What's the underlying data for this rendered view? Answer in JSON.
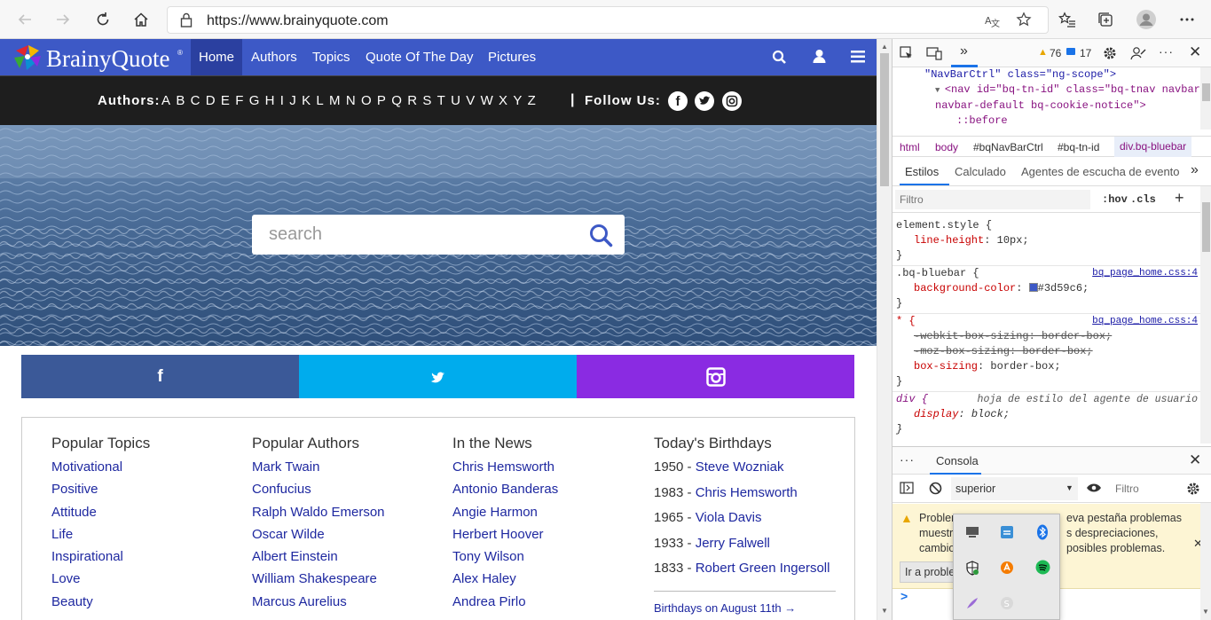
{
  "browser": {
    "url": "https://www.brainyquote.com",
    "back_icon": "back-arrow-icon",
    "forward_icon": "forward-arrow-icon",
    "reload_icon": "reload-icon",
    "home_icon": "home-icon"
  },
  "site": {
    "logo_text": "BrainyQuote",
    "logo_reg": "®",
    "nav": [
      "Home",
      "Authors",
      "Topics",
      "Quote Of The Day",
      "Pictures"
    ],
    "authors_label": "Authors:",
    "letters": [
      "A",
      "B",
      "C",
      "D",
      "E",
      "F",
      "G",
      "H",
      "I",
      "J",
      "K",
      "L",
      "M",
      "N",
      "O",
      "P",
      "Q",
      "R",
      "S",
      "T",
      "U",
      "V",
      "W",
      "X",
      "Y",
      "Z"
    ],
    "divider": "|",
    "follow_label": "Follow Us:",
    "search_placeholder": "search",
    "colors": {
      "bluebar": "#3d59c6",
      "facebook": "#3b5998",
      "twitter": "#00aced",
      "instagram": "#8a2be2"
    }
  },
  "panel": {
    "popular_topics": {
      "title": "Popular Topics",
      "items": [
        "Motivational",
        "Positive",
        "Attitude",
        "Life",
        "Inspirational",
        "Love",
        "Beauty"
      ]
    },
    "popular_authors": {
      "title": "Popular Authors",
      "items": [
        "Mark Twain",
        "Confucius",
        "Ralph Waldo Emerson",
        "Oscar Wilde",
        "Albert Einstein",
        "William Shakespeare",
        "Marcus Aurelius"
      ]
    },
    "in_the_news": {
      "title": "In the News",
      "items": [
        "Chris Hemsworth",
        "Antonio Banderas",
        "Angie Harmon",
        "Herbert Hoover",
        "Tony Wilson",
        "Alex Haley",
        "Andrea Pirlo"
      ]
    },
    "birthdays": {
      "title": "Today's Birthdays",
      "items": [
        {
          "year": "1950 - ",
          "name": "Steve Wozniak"
        },
        {
          "year": "1983 - ",
          "name": "Chris Hemsworth"
        },
        {
          "year": "1965 - ",
          "name": "Viola Davis"
        },
        {
          "year": "1933 - ",
          "name": "Jerry Falwell"
        },
        {
          "year": "1833 - ",
          "name": "Robert Green Ingersoll"
        }
      ],
      "more_link": "Birthdays on August 11th →"
    }
  },
  "devtools": {
    "warnings": "76",
    "messages": "17",
    "dom_lines": [
      "\"NavBarCtrl\" class=\"ng-scope\">",
      "<nav id=\"bq-tn-id\" class=\"bq-tnav navbar",
      "navbar-default bq-cookie-notice\">",
      "::before"
    ],
    "breadcrumbs": [
      "html",
      "body",
      "#bqNavBarCtrl",
      "#bq-tn-id",
      "div.bq-bluebar"
    ],
    "style_tabs": [
      "Estilos",
      "Calculado",
      "Agentes de escucha de evento"
    ],
    "filter_placeholder": "Filtro",
    "hov": ":hov",
    "cls": ".cls",
    "rules": {
      "r1_selector": "element.style {",
      "r1_prop": "line-height",
      "r1_val": "10px;",
      "r2_selector": ".bq-bluebar {",
      "r2_source": "bq_page_home.css:4",
      "r2_prop": "background-color",
      "r2_val": "#3d59c6;",
      "r3_selector": "* {",
      "r3_source": "bq_page_home.css:4",
      "r3_p1": "-webkit-box-sizing: border-box;",
      "r3_p2": "-moz-box-sizing: border-box;",
      "r3_p3_prop": "box-sizing",
      "r3_p3_val": "border-box;",
      "r4_selector": "div {",
      "r4_source": "hoja de estilo del agente de usuario",
      "r4_prop": "display",
      "r4_val": "block;",
      "close": "}"
    },
    "drawer_tab": "Consola",
    "context": "superior",
    "console_filter": "Filtro",
    "banner_lines": [
      "Problem",
      "muestr",
      "cambio"
    ],
    "banner_right": [
      "eva pestaña problemas",
      "s despreciaciones,",
      "posibles problemas."
    ],
    "banner_button": "Ir a proble",
    "prompt": ">"
  }
}
